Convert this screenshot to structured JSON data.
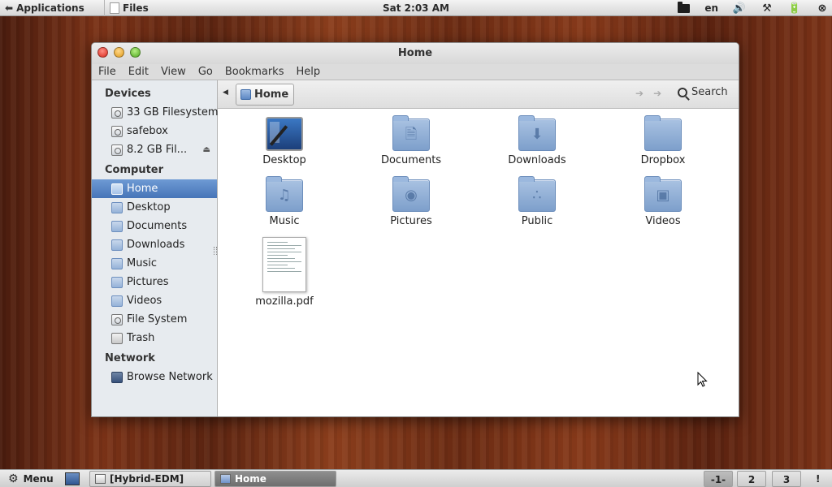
{
  "top_panel": {
    "applications_label": "Applications",
    "active_app_label": "Files",
    "clock": "Sat  2:03 AM",
    "keyboard_layout": "en"
  },
  "window": {
    "title": "Home",
    "menu": [
      "File",
      "Edit",
      "View",
      "Go",
      "Bookmarks",
      "Help"
    ]
  },
  "sidebar": {
    "devices_heading": "Devices",
    "devices": [
      "33 GB Filesystem",
      "safebox",
      "8.2 GB Fil..."
    ],
    "computer_heading": "Computer",
    "computer": [
      "Home",
      "Desktop",
      "Documents",
      "Downloads",
      "Music",
      "Pictures",
      "Videos",
      "File System",
      "Trash"
    ],
    "network_heading": "Network",
    "network": [
      "Browse Network"
    ]
  },
  "pathbar": {
    "crumb": "Home",
    "search_label": "Search"
  },
  "files": [
    {
      "name": "Desktop",
      "icon": "desktop-folder-icon"
    },
    {
      "name": "Documents",
      "icon": "documents-folder-icon"
    },
    {
      "name": "Downloads",
      "icon": "downloads-folder-icon"
    },
    {
      "name": "Dropbox",
      "icon": "dropbox-folder-icon"
    },
    {
      "name": "Music",
      "icon": "music-folder-icon"
    },
    {
      "name": "Pictures",
      "icon": "pictures-folder-icon"
    },
    {
      "name": "Public",
      "icon": "public-folder-icon"
    },
    {
      "name": "Videos",
      "icon": "videos-folder-icon"
    },
    {
      "name": "mozilla.pdf",
      "icon": "pdf-file-icon"
    }
  ],
  "bottom_panel": {
    "menu_label": "Menu",
    "tasks": [
      "[Hybrid-EDM]",
      "Home"
    ],
    "workspaces": [
      "-1-",
      "2",
      "3"
    ],
    "alert": "!"
  }
}
